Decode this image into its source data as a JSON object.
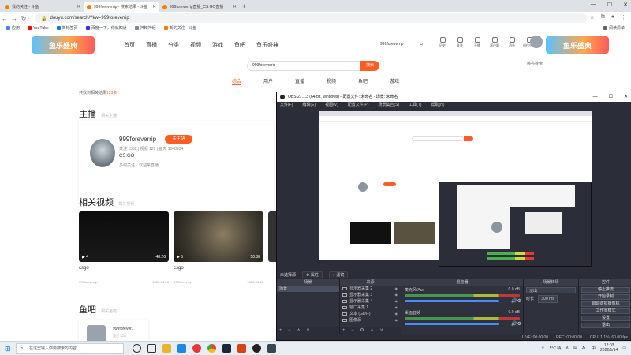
{
  "browser": {
    "tabs": [
      {
        "label": "我的关注 - 斗鱼",
        "active": false
      },
      {
        "label": "999foreverrip - 搜索结果 - 斗鱼",
        "active": true
      },
      {
        "label": "999foreverrip直播_CS:GO直播",
        "active": false
      }
    ],
    "url": "douyu.com/search/?kw=999foreverrip",
    "bookmarks": [
      "应用",
      "YouTube",
      "新标签页",
      "百度一下，你就知道",
      "神精神经",
      "新的关注 - 斗鱼"
    ],
    "bookmarks_right": "阅读清单"
  },
  "douyu": {
    "logo_text": "鱼乐盛典",
    "nav": [
      "首页",
      "直播",
      "分类",
      "视频",
      "游戏",
      "鱼吧",
      "鱼乐盛典"
    ],
    "username": "999foreverrip",
    "header_icons": [
      "历史",
      "关注",
      "开播",
      "客户端",
      "消息",
      "创作中心"
    ],
    "search_value": "999foreverrip",
    "search_button": "搜索",
    "history_label": "擦亮搜索",
    "categories": [
      "综合",
      "用户",
      "直播",
      "视频",
      "鱼吧",
      "游戏"
    ],
    "found_text": "共找到相关结果",
    "found_count": "123条",
    "sections": {
      "anchor": "主播",
      "anchor_sub": "相关主播",
      "videos": "相关视频",
      "videos_sub": "相关视频",
      "fishbar": "鱼吧",
      "fishbar_sub": "相关鱼吧"
    },
    "anchor": {
      "name": "999foreverrip",
      "follow": "关注TA",
      "stats": "关注 1362 | 视频 121 | 鱼丸 1048934",
      "game": "CS:GO",
      "desc": "多谢关注，欢迎来直播"
    },
    "videos": [
      {
        "title": "csgo",
        "count": "4",
        "duration": "48:26",
        "author": "999foreverrip",
        "date": "2022-01-13"
      },
      {
        "title": "csgo",
        "count": "5",
        "duration": "50:38",
        "author": "999foreverrip",
        "date": "2022-01-12"
      }
    ],
    "fishbar": {
      "name": "999forever...",
      "sub": "关注 12人"
    }
  },
  "obs": {
    "title": "OBS 27.1.3 (64-bit, windows) - 配置文件: 未命名 - 场景: 未命名",
    "menu": [
      "文件(F)",
      "编辑(E)",
      "视图(V)",
      "配置文件(P)",
      "场景集合(S)",
      "工具(T)",
      "帮助(H)"
    ],
    "status_label": "未选择源",
    "props_btn": "属性",
    "filters_btn": "滤镜",
    "docks": {
      "scenes": {
        "title": "场景",
        "items": [
          "场景"
        ]
      },
      "sources": {
        "title": "来源",
        "items": [
          "显示器采集 2",
          "显示器采集 3",
          "显示器采集 4",
          "窗口采集 1",
          "文本 (GDI+)",
          "图像源"
        ]
      },
      "mixer": {
        "title": "混音器",
        "rows": [
          {
            "name": "麦克风/Aux",
            "db": "0.0 dB"
          },
          {
            "name": "桌面音频",
            "db": "0.0 dB"
          }
        ]
      },
      "transitions": {
        "title": "场景转场",
        "type": "淡出",
        "duration_label": "时长",
        "duration": "300 ms"
      },
      "controls": {
        "title": "控件",
        "buttons": [
          "停止推流",
          "开始录制",
          "启动虚拟摄像机",
          "工作室模式",
          "设置",
          "退出"
        ]
      }
    },
    "statusbar": [
      "LIVE: 00:00:00",
      "REC: 00:00:00",
      "CPU: 1.1%, 60.00 fps"
    ]
  },
  "taskbar": {
    "search_placeholder": "在这里输入你要搜索的内容",
    "weather": "5°C 晴",
    "time": "12:03",
    "date": "2022/1/14"
  }
}
